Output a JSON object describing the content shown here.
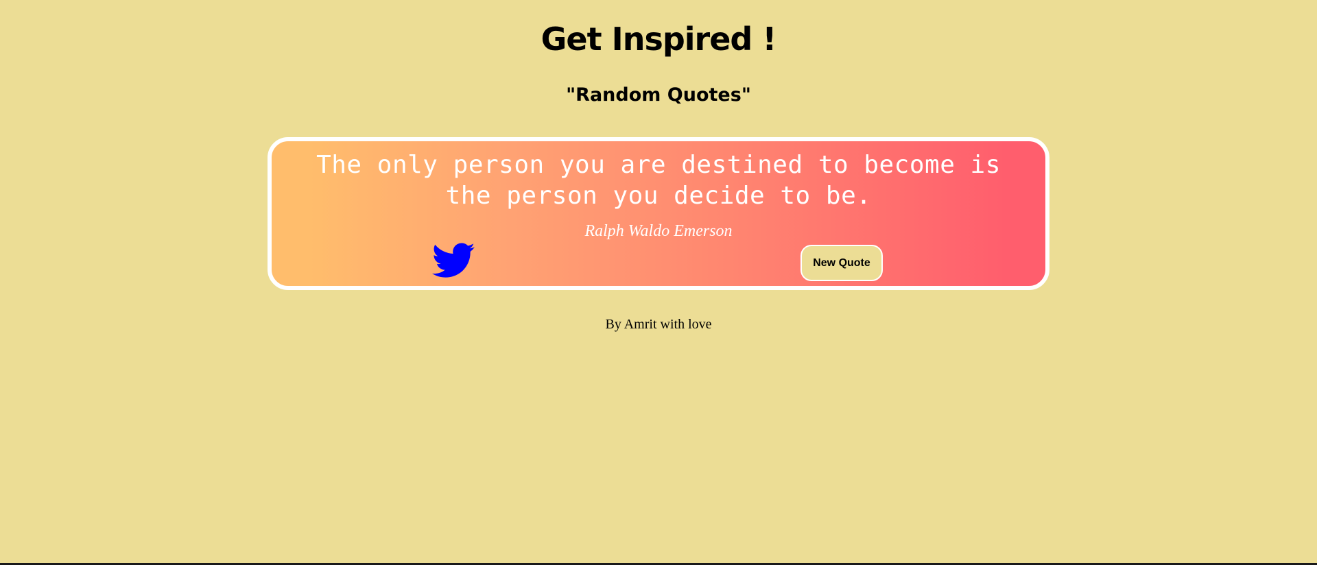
{
  "header": {
    "title": "Get Inspired !",
    "subtitle": "\"Random Quotes\""
  },
  "quote_card": {
    "quote": "The only person you are destined to become is the person you decide to be.",
    "author": "Ralph Waldo Emerson",
    "tweet_icon": "twitter-bird-icon",
    "new_quote_label": "New Quote"
  },
  "footer": {
    "credit": "By Amrit with love"
  },
  "colors": {
    "page_background": "#ecdd95",
    "card_gradient_start": "#ffbd6c",
    "card_gradient_end": "#ff5e6d",
    "card_border": "#ffffff",
    "quote_text": "#ffffff",
    "twitter_icon": "#0000ff",
    "button_background": "#ecdd95"
  }
}
